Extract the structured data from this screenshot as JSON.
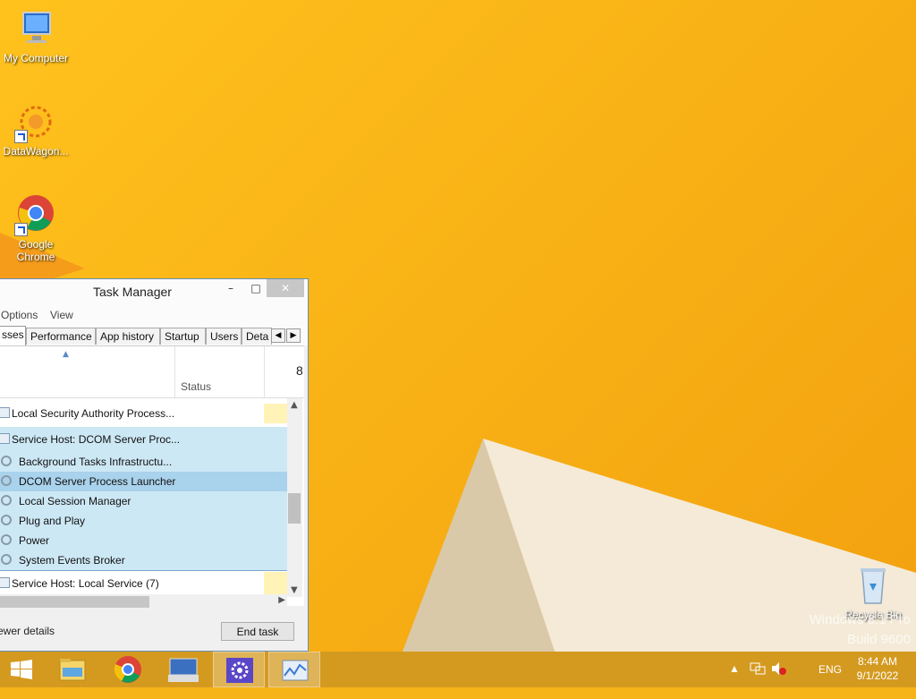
{
  "desktop": {
    "icons": [
      {
        "label": "My Computer"
      },
      {
        "label": "DataWagon..."
      },
      {
        "label": "Google Chrome"
      }
    ],
    "recycle_bin": "Recycle Bin",
    "watermark_line1": "Windows 8.1 Pro",
    "watermark_line2": "Build 9600"
  },
  "task_manager": {
    "title": "Task Manager",
    "menu": [
      "Options",
      "View"
    ],
    "tabs": [
      "sses",
      "Performance",
      "App history",
      "Startup",
      "Users",
      "Deta"
    ],
    "header": {
      "status_label": "Status",
      "cpu_fragment": "8"
    },
    "rows": [
      {
        "label": "Local Security Authority Process...",
        "kind": "process"
      },
      {
        "label": "Service Host: DCOM Server Proc...",
        "kind": "group"
      },
      {
        "label": "Background Tasks Infrastructu...",
        "kind": "service"
      },
      {
        "label": "DCOM Server Process Launcher",
        "kind": "service-selected"
      },
      {
        "label": "Local Session Manager",
        "kind": "service"
      },
      {
        "label": "Plug and Play",
        "kind": "service"
      },
      {
        "label": "Power",
        "kind": "service"
      },
      {
        "label": "System Events Broker",
        "kind": "service"
      },
      {
        "label": "Service Host: Local Service (7)",
        "kind": "process"
      }
    ],
    "fewer_details": "ewer details",
    "end_task": "End task"
  },
  "taskbar": {
    "items": [
      "start-icon",
      "file-explorer-icon",
      "chrome-icon",
      "keyboard-icon",
      "settings-icon",
      "task-manager-icon"
    ],
    "language": "ENG",
    "time": "8:44 AM",
    "date": "9/1/2022"
  }
}
